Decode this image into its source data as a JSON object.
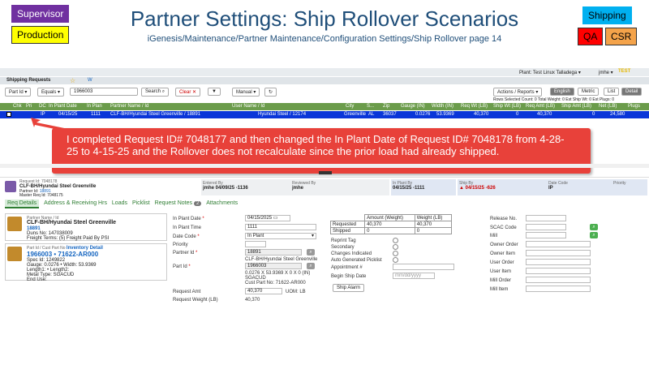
{
  "tags": {
    "supervisor": "Supervisor",
    "production": "Production",
    "shipping": "Shipping",
    "qa": "QA",
    "csr": "CSR"
  },
  "title": "Partner Settings: Ship Rollover Scenarios",
  "subtitle": "iGenesis/Maintenance/Partner Maintenance/Configuration Settings/Ship Rollover page 14",
  "topbar": {
    "plant": "Plant: Test Linux Talladega ▾",
    "user": "jmhe ▾",
    "env": "TEST"
  },
  "module": {
    "title": "Shipping Requests",
    "star": "☆",
    "w": "W"
  },
  "filter": {
    "field": "Part Id",
    "op": "Equals",
    "value": "1966003",
    "search": "Search",
    "clear": "Clear ✕",
    "manual": "Manual"
  },
  "actions": {
    "actions": "Actions / Reports",
    "english": "English",
    "metric": "Metric",
    "list": "List",
    "detail": "Detail"
  },
  "counts": "Rows Selected Count: 0  Total Weight: 0  Est Ship Wt: 0  Est Plugs: 0",
  "columns": [
    "Chk",
    "Pri",
    "DC",
    "In Plant Date",
    "In Plan",
    "Partner Name / Id",
    "User Name / Id",
    "City",
    "S...",
    "Zip",
    "Gauge (IN)",
    "Width (IN)",
    "Req Wt (LB)",
    "Ship Wt (LB)",
    "Req Amt (LB)",
    "Ship Amt (LB)",
    "Net (LB)",
    "Plugs"
  ],
  "row": {
    "dc": "IP",
    "date": "04/15/25",
    "plan": "1111",
    "partner": "CLF-BH/Hyundai Steel Greenville / 18891",
    "user": "Hyundai Steel / 12174",
    "city": "Greenville",
    "state": "AL",
    "zip": "36037",
    "gauge": "0.0276",
    "width": "53.9369",
    "reqwt": "40,370",
    "shipwt": "0",
    "reqamt": "40,370",
    "shipamt": "0",
    "net": "24,580"
  },
  "callout": "I completed Request ID# 7048177 and then changed the In Plant Date of Request ID# 7048178 from 4-28-25 to 4-15-25 and the Rollover does not recalculate since the prior load had already shipped.",
  "detailhdr": {
    "reqid": "Request Id: 7048178",
    "partner": "CLF-BH/Hyundai Steel Greenville",
    "partnerid_lbl": "Partner Id:",
    "partnerid": "18891",
    "master": "Master Req Id: 7048175",
    "entered_lbl": "Entered By",
    "entered": "jmhe 04/09/25 -1136",
    "reviewed_lbl": "Reviewed By",
    "reviewed": "jmhe",
    "inplant_lbl": "In Plant By",
    "inplant": "04/15/25 -1111",
    "ship_lbl": "Ship By",
    "ship": "04/15/25 -626",
    "datecode_lbl": "Date Code",
    "datecode": "IP",
    "priority_lbl": "Priority"
  },
  "tabs": [
    "Req Details",
    "Address & Receiving Hrs",
    "Loads",
    "Picklist",
    "Request Notes",
    "Attachments"
  ],
  "notes_count": "2",
  "card1": {
    "l1": "Partner Name / Id",
    "name": "CLF-BH/Hyundai Steel Greenville",
    "id": "18891",
    "duns": "Duns No: 147038009",
    "freight": "Freight Terms: (5) Freight Paid By PSI"
  },
  "card2": {
    "l1": "Part Id / Cust Part No",
    "inv": "Inventory Detail",
    "part": "1966003 • 71622-AR000",
    "spec": "Spec Id: 1249822",
    "gauge": "Gauge: 0.0276 • Width: 53.9369",
    "len": "Length1: • Length2:",
    "metal": "Metal Type: SGACUD",
    "enduse": "End Use:"
  },
  "form": {
    "inplantdate_lbl": "In Plant Date",
    "inplantdate": "04/15/2025",
    "inplanttime_lbl": "In Plant Time",
    "inplanttime": "1111",
    "datecode_lbl": "Date Code",
    "datecode": "In Plant",
    "priority_lbl": "Priority",
    "partner_lbl": "Partner Id",
    "partner": "18891",
    "partner_name": "CLF-BH/Hyundai Steel Greenville",
    "part_lbl": "Part Id",
    "part": "1966003",
    "part_desc1": "0.0276 X 53.9369 X 0 X 0 (IN)",
    "part_desc2": "SGACUD",
    "part_desc3": "Cust Part No: 71622-AR000",
    "reqamt_lbl": "Request Amt",
    "reqamt": "40,370",
    "uom": "UOM: LB",
    "reqwt_lbl": "Request Weight (LB)",
    "reqwt": "40,370"
  },
  "amttbl": {
    "h1": "Amount (Weight)",
    "h2": "Weight (LB)",
    "r1": "Requested",
    "r1a": "40,370",
    "r1b": "40,370",
    "r2": "Shipped",
    "r2a": "0",
    "r2b": "0"
  },
  "checks": [
    "Reprint Tag",
    "Secondary",
    "Changes Indicated",
    "Auto Generated Picklist"
  ],
  "appt_lbl": "Appointment #",
  "beginship_lbl": "Begin Ship Date",
  "beginship_ph": "mm/dd/yyyy",
  "shipalarm": "Ship Alarm",
  "right": [
    "Release No.",
    "SCAC Code",
    "Mill",
    "Owner Order",
    "Owner Item",
    "User Order",
    "User Item",
    "Mill Order",
    "Mill Item"
  ]
}
